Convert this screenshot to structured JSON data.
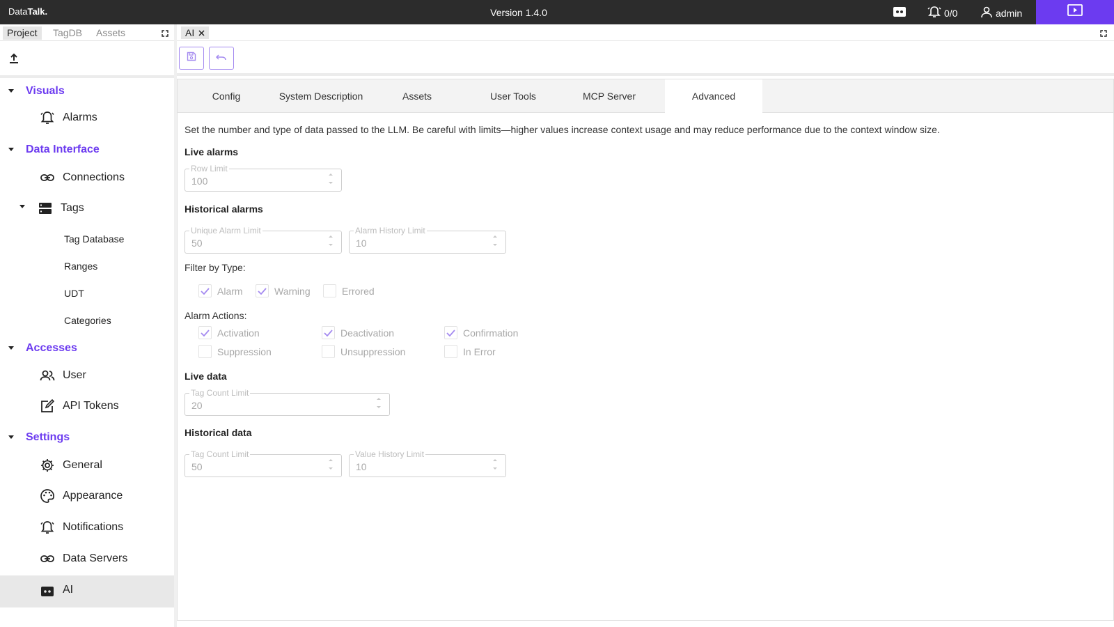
{
  "app": {
    "brand_prefix": "Data",
    "brand_bold": "Talk.",
    "version": "Version 1.4.0",
    "alarm_count": "0/0",
    "user": "admin",
    "accent": "#6c3bf0"
  },
  "left_tabs": {
    "project": "Project",
    "tagdb": "TagDB",
    "assets": "Assets"
  },
  "tree": {
    "visuals": "Visuals",
    "alarms": "Alarms",
    "data_interface": "Data Interface",
    "connections": "Connections",
    "tags": "Tags",
    "tag_database": "Tag Database",
    "ranges": "Ranges",
    "udt": "UDT",
    "categories": "Categories",
    "accesses": "Accesses",
    "user": "User",
    "api_tokens": "API Tokens",
    "settings": "Settings",
    "general": "General",
    "appearance": "Appearance",
    "notifications": "Notifications",
    "data_servers": "Data Servers",
    "ai": "AI"
  },
  "editor_tab": "AI",
  "content_tabs": [
    "Config",
    "System Description",
    "Assets",
    "User Tools",
    "MCP Server",
    "Advanced"
  ],
  "advanced": {
    "description": "Set the number and type of data passed to the LLM. Be careful with limits—higher values increase context usage and may reduce performance due to the context window size.",
    "live_alarms": {
      "title": "Live alarms",
      "row_limit_label": "Row Limit",
      "row_limit": "100"
    },
    "historical_alarms": {
      "title": "Historical alarms",
      "unique_label": "Unique Alarm Limit",
      "unique": "50",
      "history_label": "Alarm History Limit",
      "history": "10"
    },
    "filter_by_type": {
      "label": "Filter by Type:",
      "alarm": "Alarm",
      "warning": "Warning",
      "errored": "Errored"
    },
    "alarm_actions": {
      "label": "Alarm Actions:",
      "activation": "Activation",
      "deactivation": "Deactivation",
      "confirmation": "Confirmation",
      "suppression": "Suppression",
      "unsuppression": "Unsuppression",
      "in_error": "In Error"
    },
    "live_data": {
      "title": "Live data",
      "tag_count_label": "Tag Count Limit",
      "tag_count": "20"
    },
    "historical_data": {
      "title": "Historical data",
      "tag_count_label": "Tag Count Limit",
      "tag_count": "50",
      "value_history_label": "Value History Limit",
      "value_history": "10"
    }
  }
}
